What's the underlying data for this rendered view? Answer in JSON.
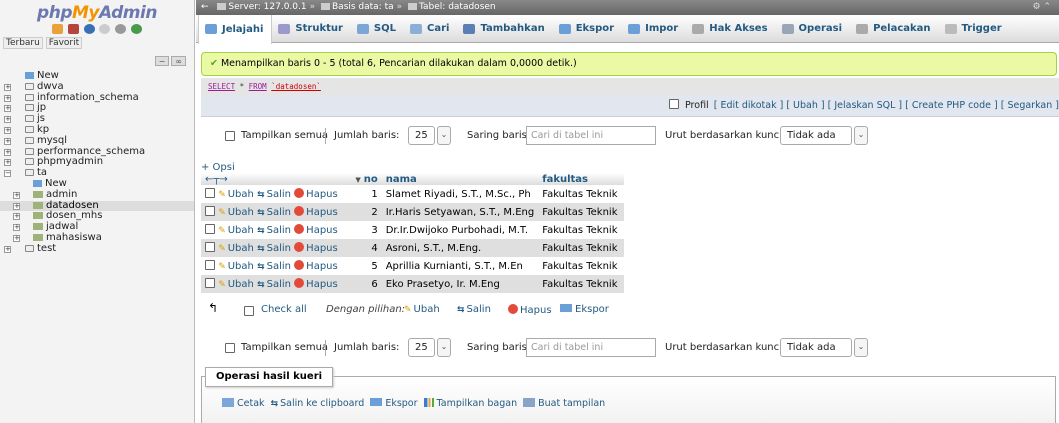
{
  "nav": {
    "logo_php": "php",
    "logo_my": "My",
    "logo_admin": "Admin",
    "tabs": [
      "Terbaru",
      "Favorit"
    ],
    "tree": [
      {
        "label": "New",
        "level": 0,
        "kind": "new"
      },
      {
        "label": "dwva",
        "level": 0,
        "kind": "db"
      },
      {
        "label": "information_schema",
        "level": 0,
        "kind": "db"
      },
      {
        "label": "jp",
        "level": 0,
        "kind": "db"
      },
      {
        "label": "js",
        "level": 0,
        "kind": "db"
      },
      {
        "label": "kp",
        "level": 0,
        "kind": "db"
      },
      {
        "label": "mysql",
        "level": 0,
        "kind": "db"
      },
      {
        "label": "performance_schema",
        "level": 0,
        "kind": "db"
      },
      {
        "label": "phpmyadmin",
        "level": 0,
        "kind": "db"
      },
      {
        "label": "ta",
        "level": 0,
        "kind": "db-open"
      },
      {
        "label": "New",
        "level": 1,
        "kind": "new"
      },
      {
        "label": "admin",
        "level": 1,
        "kind": "table"
      },
      {
        "label": "datadosen",
        "level": 1,
        "kind": "table",
        "selected": true
      },
      {
        "label": "dosen_mhs",
        "level": 1,
        "kind": "table"
      },
      {
        "label": "jadwal",
        "level": 1,
        "kind": "table"
      },
      {
        "label": "mahasiswa",
        "level": 1,
        "kind": "table"
      },
      {
        "label": "test",
        "level": 0,
        "kind": "db"
      }
    ]
  },
  "breadcrumb": {
    "server": "Server: 127.0.0.1",
    "database": "Basis data: ta",
    "table": "Tabel: datadosen"
  },
  "menu": [
    {
      "label": "Jelajahi",
      "icon": "browse-icon",
      "color": "#6a9fd8",
      "active": true
    },
    {
      "label": "Struktur",
      "icon": "structure-icon",
      "color": "#9a9acb"
    },
    {
      "label": "SQL",
      "icon": "sql-icon",
      "color": "#7aa7d8"
    },
    {
      "label": "Cari",
      "icon": "search-icon",
      "color": "#8bb0d8"
    },
    {
      "label": "Tambahkan",
      "icon": "insert-icon",
      "color": "#5a7fb5"
    },
    {
      "label": "Ekspor",
      "icon": "export-icon",
      "color": "#6a9fd8"
    },
    {
      "label": "Impor",
      "icon": "import-icon",
      "color": "#6a9fd8"
    },
    {
      "label": "Hak Akses",
      "icon": "privileges-icon",
      "color": "#aaaaaa"
    },
    {
      "label": "Operasi",
      "icon": "wrench-icon",
      "color": "#9aa6b5"
    },
    {
      "label": "Pelacakan",
      "icon": "eye-icon",
      "color": "#aaaaaa"
    },
    {
      "label": "Trigger",
      "icon": "trigger-icon",
      "color": "#bbbbbb"
    }
  ],
  "success_message": "Menampilkan baris 0 - 5 (total 6, Pencarian dilakukan dalam 0,0000 detik.)",
  "sql": {
    "keyword_select": "SELECT",
    "middle": " * ",
    "keyword_from": "FROM",
    "table": "`datadosen`"
  },
  "sql_links": {
    "profil": "Profil",
    "links": "[ Edit dikotak ] [ Ubah ] [ Jelaskan SQL ] [ Create PHP code ] [ Segarkan ]"
  },
  "pager": {
    "show_all": "Tampilkan semua",
    "rows_label": "Jumlah baris:",
    "rows_value": "25",
    "filter_label": "Saring baris:",
    "filter_placeholder": "Cari di tabel ini",
    "sort_label": "Urut berdasarkan kunci:",
    "sort_value": "Tidak ada"
  },
  "options_link": "+ Opsi",
  "table": {
    "headers": [
      "no",
      "nama",
      "fakultas"
    ],
    "action_labels": {
      "edit": "Ubah",
      "copy": "Salin",
      "delete": "Hapus"
    },
    "rows": [
      {
        "no": "1",
        "nama": "Slamet Riyadi, S.T., M.Sc., Ph",
        "fakultas": "Fakultas Teknik"
      },
      {
        "no": "2",
        "nama": "Ir.Haris Setyawan, S.T., M.Eng",
        "fakultas": "Fakultas Teknik"
      },
      {
        "no": "3",
        "nama": "Dr.Ir.Dwijoko Purbohadi, M.T.",
        "fakultas": "Fakultas Teknik"
      },
      {
        "no": "4",
        "nama": "Asroni, S.T., M.Eng.",
        "fakultas": "Fakultas Teknik"
      },
      {
        "no": "5",
        "nama": "Aprillia Kurnianti, S.T., M.En",
        "fakultas": "Fakultas Teknik"
      },
      {
        "no": "6",
        "nama": "Eko Prasetyo, Ir. M.Eng",
        "fakultas": "Fakultas Teknik"
      }
    ]
  },
  "bulk": {
    "check_all": "Check all",
    "with_selected": "Dengan pilihan:",
    "edit": "Ubah",
    "copy": "Salin",
    "delete": "Hapus",
    "export": "Ekspor"
  },
  "query_ops": {
    "title": "Operasi hasil kueri",
    "print": "Cetak",
    "copy_clipboard": "Salin ke clipboard",
    "export": "Ekspor",
    "chart": "Tampilkan bagan",
    "create_view": "Buat tampilan"
  }
}
